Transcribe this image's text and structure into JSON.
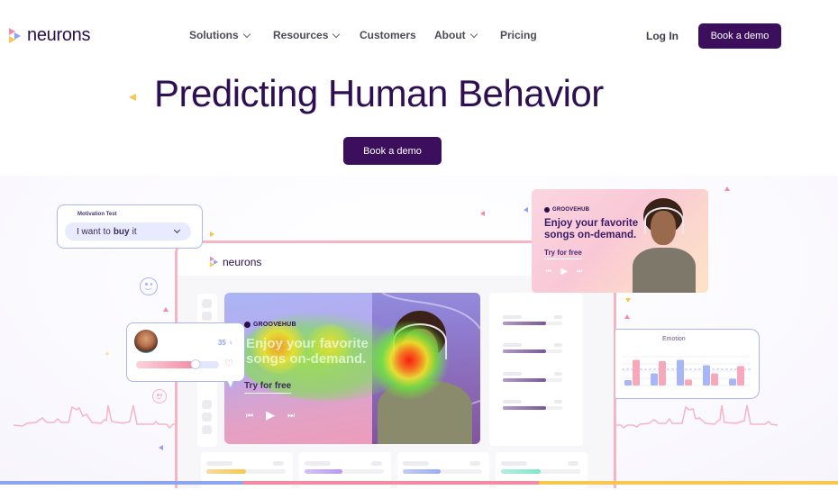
{
  "nav": {
    "logo_text": "neurons",
    "items": [
      {
        "label": "Solutions",
        "has_dropdown": true
      },
      {
        "label": "Resources",
        "has_dropdown": true
      },
      {
        "label": "Customers",
        "has_dropdown": false
      },
      {
        "label": "About",
        "has_dropdown": true
      },
      {
        "label": "Pricing",
        "has_dropdown": false
      }
    ],
    "login_label": "Log In",
    "cta_label": "Book a demo"
  },
  "hero": {
    "title": "Predicting Human Behavior",
    "cta_label": "Book a demo"
  },
  "colors": {
    "brand_dark": "#3b0f5c",
    "title": "#2e0f52",
    "accent_pink": "#f58ba3",
    "accent_blue": "#8fa3f5",
    "accent_yellow": "#f9c74f"
  },
  "app_window": {
    "logo_text": "neurons",
    "ad": {
      "brand": "GROOVEHUB",
      "headline_line1": "Enjoy your favorite",
      "headline_line2": "songs on-demand.",
      "cta": "Try for free",
      "controls": {
        "prev": "⏮",
        "play": "▶",
        "next": "⏭"
      }
    },
    "metric_bars": [
      0.72,
      0.72,
      0.72,
      0.72
    ],
    "bottom_cards": [
      {
        "fill": 0.5,
        "color": "#f9c74f"
      },
      {
        "fill": 0.48,
        "color": "#b89af5"
      },
      {
        "fill": 0.48,
        "color": "#9aacf5"
      },
      {
        "fill": 0.5,
        "color": "#7fe8cc"
      }
    ]
  },
  "motivation_test": {
    "label": "Motivation Test",
    "select_prefix": "I want to",
    "select_bold": "buy",
    "select_suffix": "it"
  },
  "floating_ad": {
    "brand": "GROOVEHUB",
    "headline_line1": "Enjoy your favorite",
    "headline_line2": "songs on-demand.",
    "cta": "Try for free",
    "controls": {
      "prev": "⏮",
      "play": "▶",
      "next": "⏭"
    }
  },
  "person_card": {
    "count": "35",
    "count_icon": "♀",
    "slider_value": 0.72,
    "heart_icon": "♡"
  },
  "emotion_card": {
    "title": "Emotion",
    "bars": [
      {
        "blue": 0.2,
        "pink": 0.95
      },
      {
        "blue": 0.45,
        "pink": 0.9
      },
      {
        "blue": 0.95,
        "pink": 0.22
      },
      {
        "blue": 0.75,
        "pink": 0.45
      },
      {
        "blue": 0.25,
        "pink": 0.72
      }
    ]
  }
}
